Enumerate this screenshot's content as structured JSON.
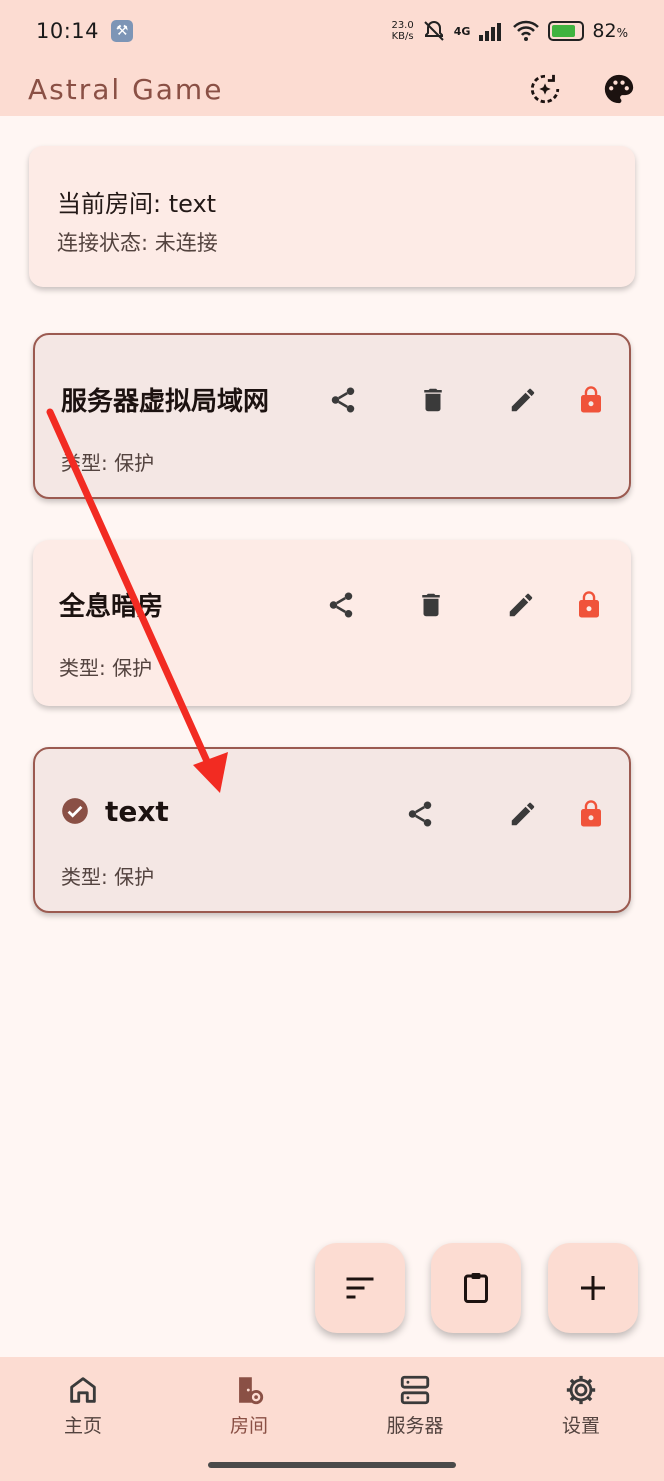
{
  "status_bar": {
    "time": "10:14",
    "net_speed_value": "23.0",
    "net_speed_unit": "KB/s",
    "network": "4G",
    "battery_percent": "82",
    "battery_unit": "%"
  },
  "app_bar": {
    "title": "Astral Game",
    "icons": [
      "sync-icon",
      "palette-icon"
    ]
  },
  "connection": {
    "current_room": "当前房间: text",
    "status": "连接状态: 未连接"
  },
  "rooms": [
    {
      "name": "服务器虚拟局域网",
      "type": "类型: 保护",
      "selected": false,
      "deletable": true
    },
    {
      "name": "全息暗房",
      "type": "类型: 保护",
      "selected": false,
      "deletable": true
    },
    {
      "name": "text",
      "type": "类型: 保护",
      "selected": true,
      "deletable": false
    }
  ],
  "fabs": [
    "sort-icon",
    "clipboard-icon",
    "add-icon"
  ],
  "bottom_nav": {
    "items": [
      {
        "label": "主页",
        "icon": "home-icon",
        "active": false
      },
      {
        "label": "房间",
        "icon": "room-settings-icon",
        "active": true
      },
      {
        "label": "服务器",
        "icon": "server-icon",
        "active": false
      },
      {
        "label": "设置",
        "icon": "gear-icon",
        "active": false
      }
    ]
  },
  "colors": {
    "bar_bg": "#fcdcd2",
    "page_bg": "#fff6f3",
    "accent": "#8a5045",
    "lock": "#f0533a",
    "annotation_arrow": "#f22b22"
  }
}
